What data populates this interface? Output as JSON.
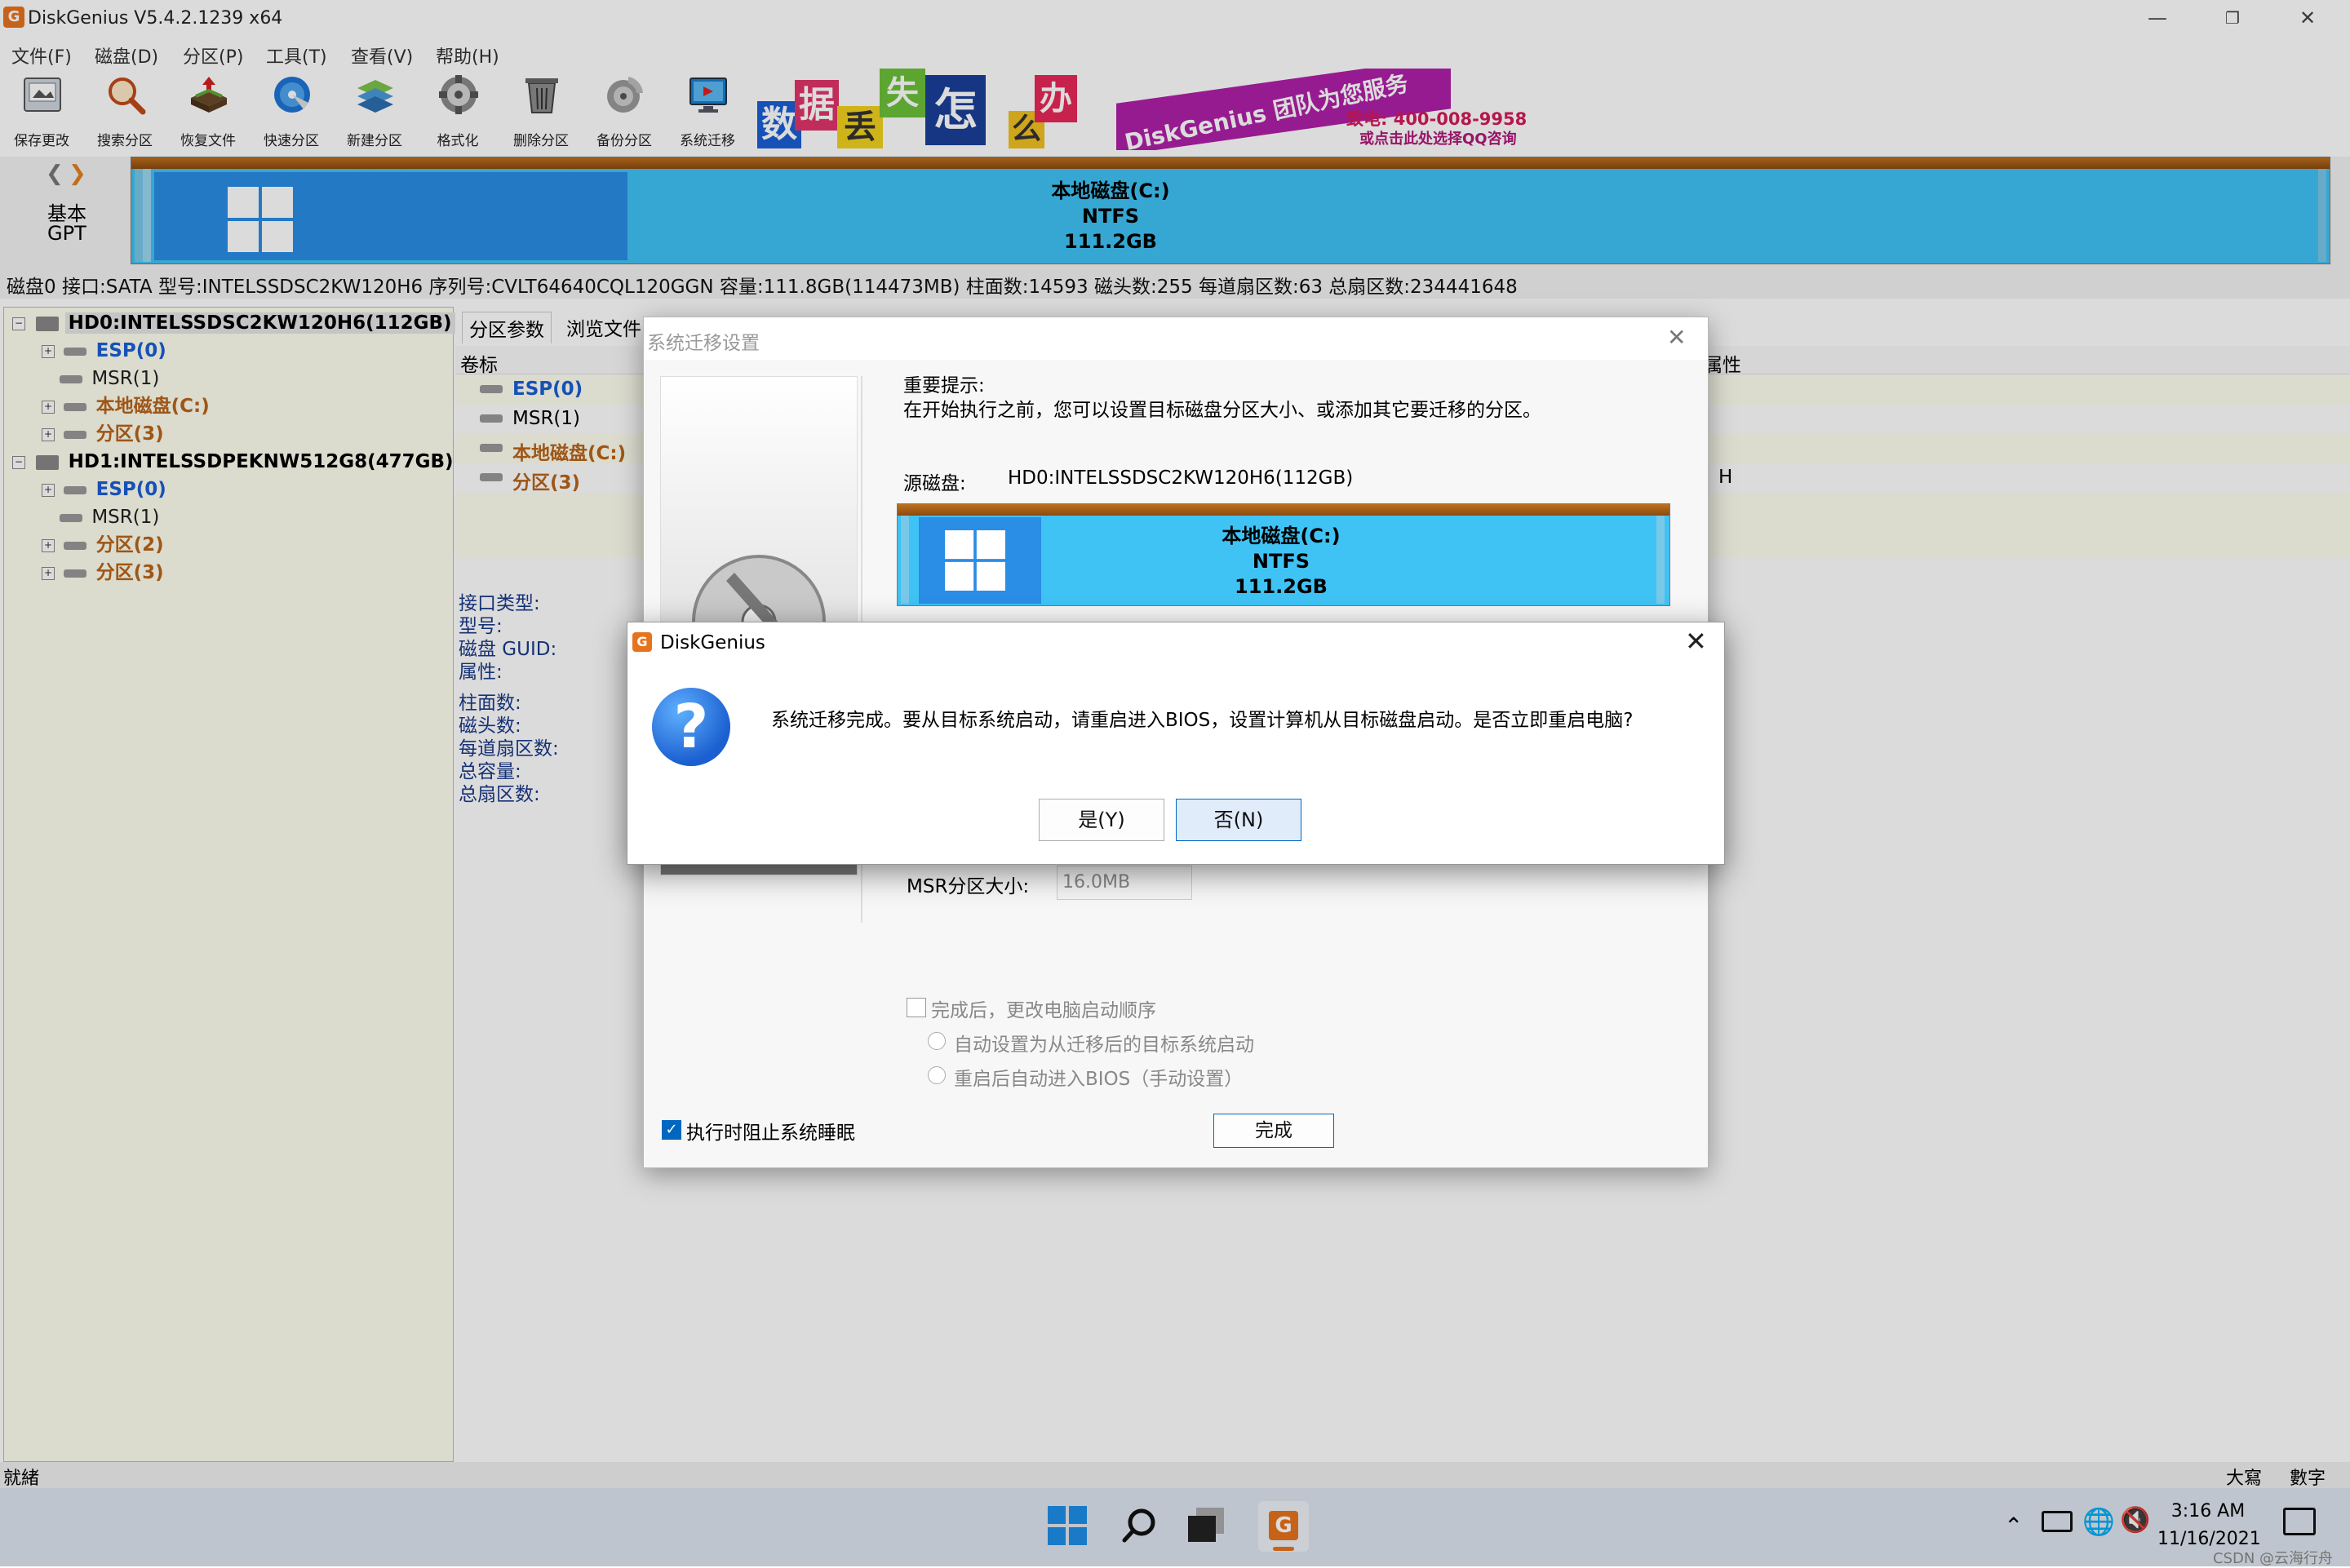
{
  "app": {
    "title": "DiskGenius V5.4.2.1239 x64",
    "logo_letter": "G"
  },
  "menu": [
    "文件(F)",
    "磁盘(D)",
    "分区(P)",
    "工具(T)",
    "查看(V)",
    "帮助(H)"
  ],
  "toolbar": [
    {
      "label": "保存更改",
      "icon": "save-icon"
    },
    {
      "label": "搜索分区",
      "icon": "search-icon"
    },
    {
      "label": "恢复文件",
      "icon": "recover-icon"
    },
    {
      "label": "快速分区",
      "icon": "quick-partition-icon"
    },
    {
      "label": "新建分区",
      "icon": "new-partition-icon"
    },
    {
      "label": "格式化",
      "icon": "format-icon"
    },
    {
      "label": "删除分区",
      "icon": "delete-icon"
    },
    {
      "label": "备份分区",
      "icon": "backup-icon"
    },
    {
      "label": "系统迁移",
      "icon": "migrate-icon"
    }
  ],
  "banner": {
    "chars": [
      "数",
      "据",
      "丢",
      "失",
      "怎",
      "么",
      "办"
    ],
    "slogan": "DiskGenius 团队为您服务",
    "phone": "致电: 400-008-9958",
    "qq": "或点击此处选择QQ咨询"
  },
  "disk_bar": {
    "type_line1": "基本",
    "type_line2": "GPT",
    "partition_name": "本地磁盘(C:)",
    "fs": "NTFS",
    "size": "111.2GB"
  },
  "disk_info": "磁盘0 接口:SATA  型号:INTELSSDSC2KW120H6  序列号:CVLT64640CQL120GGN  容量:111.8GB(114473MB)  柱面数:14593  磁头数:255  每道扇区数:63  总扇区数:234441648",
  "tree": [
    {
      "label": "HD0:INTELSSDSC2KW120H6(112GB)",
      "kind": "disk",
      "selected": true
    },
    {
      "label": "ESP(0)",
      "kind": "esp",
      "expand": true
    },
    {
      "label": "MSR(1)",
      "kind": "msr",
      "expand": false
    },
    {
      "label": "本地磁盘(C:)",
      "kind": "part",
      "expand": true
    },
    {
      "label": "分区(3)",
      "kind": "part",
      "expand": true
    },
    {
      "label": "HD1:INTELSSDPEKNW512G8(477GB)",
      "kind": "disk",
      "selected": false
    },
    {
      "label": "ESP(0)",
      "kind": "esp",
      "expand": true
    },
    {
      "label": "MSR(1)",
      "kind": "msr",
      "expand": false
    },
    {
      "label": "分区(2)",
      "kind": "part",
      "expand": true
    },
    {
      "label": "分区(3)",
      "kind": "part",
      "expand": true
    }
  ],
  "right_panel": {
    "tabs": [
      "分区参数",
      "浏览文件"
    ],
    "col_label": "卷标",
    "col_attr": "属性",
    "rows": [
      {
        "label": "ESP(0)",
        "kind": "esp"
      },
      {
        "label": "MSR(1)",
        "kind": "msr"
      },
      {
        "label": "本地磁盘(C:)",
        "kind": "part"
      },
      {
        "label": "分区(3)",
        "kind": "part"
      }
    ],
    "attr_value": "H",
    "details_1": [
      "接口类型:",
      "型号:",
      "磁盘 GUID:",
      "属性:"
    ],
    "details_2": [
      "柱面数:",
      "磁头数:",
      "每道扇区数:",
      "总容量:",
      "总扇区数:"
    ]
  },
  "migrate_dialog": {
    "title": "系统迁移设置",
    "notice_title": "重要提示:",
    "notice_text": "在开始执行之前，您可以设置目标磁盘分区大小、或添加其它要迁移的分区。",
    "source_label": "源磁盘:",
    "source_value": "HD0:INTELSSDSC2KW120H6(112GB)",
    "bar_name": "本地磁盘(C:)",
    "bar_fs": "NTFS",
    "bar_size": "111.2GB",
    "msr_label": "MSR分区大小:",
    "msr_value": "16.0MB",
    "opt_change_boot": "完成后，更改电脑启动顺序",
    "opt_auto": "自动设置为从迁移后的目标系统启动",
    "opt_bios": "重启后自动进入BIOS（手动设置）",
    "opt_prevent_sleep": "执行时阻止系统睡眠",
    "finish_button": "完成"
  },
  "message_box": {
    "title": "DiskGenius",
    "text": "系统迁移完成。要从目标系统启动，请重启进入BIOS，设置计算机从目标磁盘启动。是否立即重启电脑?",
    "yes": "是(Y)",
    "no": "否(N)"
  },
  "statusbar": {
    "left": "就緒",
    "caps": "大寫",
    "num": "數字"
  },
  "taskbar": {
    "time": "3:16 AM",
    "date": "11/16/2021",
    "watermark": "CSDN @云海行舟"
  },
  "colors": {
    "partition_orange": "#b8651a",
    "esp_blue": "#1a5fd6",
    "bar_cyan": "#3fc3f5",
    "bar_blue": "#2a8de6",
    "accent": "#0067c0"
  }
}
